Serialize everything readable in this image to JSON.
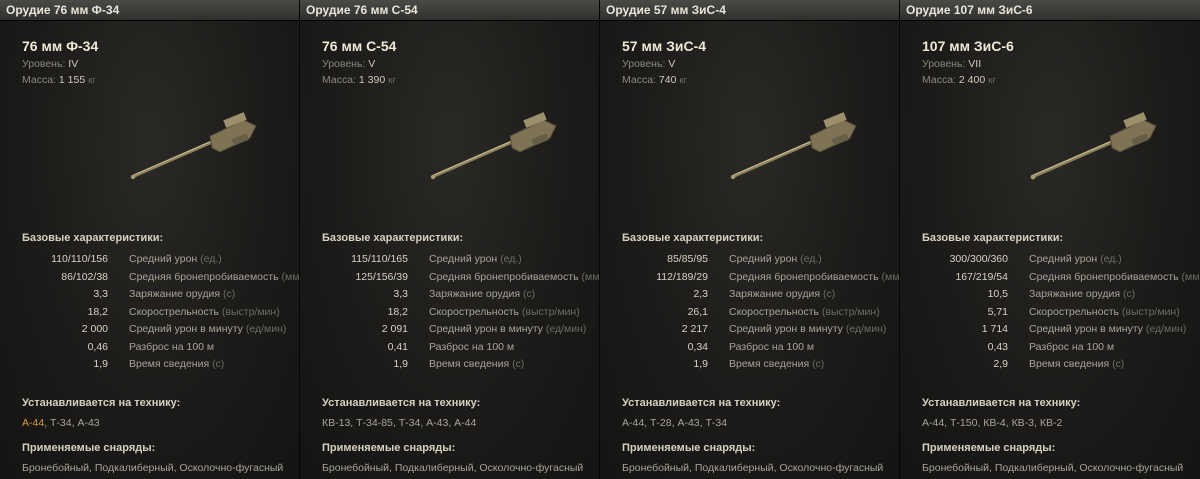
{
  "cards": [
    {
      "header": "Орудие 76 мм Ф-34",
      "name": "76 мм Ф-34",
      "level_label": "Уровень:",
      "level": "IV",
      "mass_label": "Масса:",
      "mass": "1 155",
      "mass_unit": "кг",
      "base_title": "Базовые характеристики:",
      "stats": [
        {
          "value": "110/110/156",
          "label": "Средний урон",
          "unit": "(ед.)"
        },
        {
          "value": "86/102/38",
          "label": "Средняя бронепробиваемость",
          "unit": "(мм)"
        },
        {
          "value": "3,3",
          "label": "Заряжание орудия",
          "unit": "(с)"
        },
        {
          "value": "18,2",
          "label": "Скорострельность",
          "unit": "(выстр/мин)"
        },
        {
          "value": "2 000",
          "label": "Средний урон в минуту",
          "unit": "(ед/мин)"
        },
        {
          "value": "0,46",
          "label": "Разброс на 100 м",
          "unit": ""
        },
        {
          "value": "1,9",
          "label": "Время сведения",
          "unit": "(с)"
        }
      ],
      "installed_title": "Устанавливается на технику:",
      "installed_highlight": "А-44",
      "installed_rest": ", Т-34, А-43",
      "ammo_title": "Применяемые снаряды:",
      "ammo": "Бронебойный, Подкалиберный, Осколочно-фугасный"
    },
    {
      "header": "Орудие 76 мм С-54",
      "name": "76 мм С-54",
      "level_label": "Уровень:",
      "level": "V",
      "mass_label": "Масса:",
      "mass": "1 390",
      "mass_unit": "кг",
      "base_title": "Базовые характеристики:",
      "stats": [
        {
          "value": "115/110/165",
          "label": "Средний урон",
          "unit": "(ед.)"
        },
        {
          "value": "125/156/39",
          "label": "Средняя бронепробиваемость",
          "unit": "(мм)"
        },
        {
          "value": "3,3",
          "label": "Заряжание орудия",
          "unit": "(с)"
        },
        {
          "value": "18,2",
          "label": "Скорострельность",
          "unit": "(выстр/мин)"
        },
        {
          "value": "2 091",
          "label": "Средний урон в минуту",
          "unit": "(ед/мин)"
        },
        {
          "value": "0,41",
          "label": "Разброс на 100 м",
          "unit": ""
        },
        {
          "value": "1,9",
          "label": "Время сведения",
          "unit": "(с)"
        }
      ],
      "installed_title": "Устанавливается на технику:",
      "installed_highlight": "",
      "installed_rest": "КВ-13, Т-34-85, Т-34, А-43, А-44",
      "ammo_title": "Применяемые снаряды:",
      "ammo": "Бронебойный, Подкалиберный, Осколочно-фугасный"
    },
    {
      "header": "Орудие 57 мм ЗиС-4",
      "name": "57 мм ЗиС-4",
      "level_label": "Уровень:",
      "level": "V",
      "mass_label": "Масса:",
      "mass": "740",
      "mass_unit": "кг",
      "base_title": "Базовые характеристики:",
      "stats": [
        {
          "value": "85/85/95",
          "label": "Средний урон",
          "unit": "(ед.)"
        },
        {
          "value": "112/189/29",
          "label": "Средняя бронепробиваемость",
          "unit": "(мм)"
        },
        {
          "value": "2,3",
          "label": "Заряжание орудия",
          "unit": "(с)"
        },
        {
          "value": "26,1",
          "label": "Скорострельность",
          "unit": "(выстр/мин)"
        },
        {
          "value": "2 217",
          "label": "Средний урон в минуту",
          "unit": "(ед/мин)"
        },
        {
          "value": "0,34",
          "label": "Разброс на 100 м",
          "unit": ""
        },
        {
          "value": "1,9",
          "label": "Время сведения",
          "unit": "(с)"
        }
      ],
      "installed_title": "Устанавливается на технику:",
      "installed_highlight": "",
      "installed_rest": "А-44, Т-28, А-43, Т-34",
      "ammo_title": "Применяемые снаряды:",
      "ammo": "Бронебойный, Подкалиберный, Осколочно-фугасный"
    },
    {
      "header": "Орудие 107 мм ЗиС-6",
      "name": "107 мм ЗиС-6",
      "level_label": "Уровень:",
      "level": "VII",
      "mass_label": "Масса:",
      "mass": "2 400",
      "mass_unit": "кг",
      "base_title": "Базовые характеристики:",
      "stats": [
        {
          "value": "300/300/360",
          "label": "Средний урон",
          "unit": "(ед.)"
        },
        {
          "value": "167/219/54",
          "label": "Средняя бронепробиваемость",
          "unit": "(мм)"
        },
        {
          "value": "10,5",
          "label": "Заряжание орудия",
          "unit": "(с)"
        },
        {
          "value": "5,71",
          "label": "Скорострельность",
          "unit": "(выстр/мин)"
        },
        {
          "value": "1 714",
          "label": "Средний урон в минуту",
          "unit": "(ед/мин)"
        },
        {
          "value": "0,43",
          "label": "Разброс на 100 м",
          "unit": ""
        },
        {
          "value": "2,9",
          "label": "Время сведения",
          "unit": "(с)"
        }
      ],
      "installed_title": "Устанавливается на технику:",
      "installed_highlight": "",
      "installed_rest": "А-44, Т-150, КВ-4, КВ-3, КВ-2",
      "ammo_title": "Применяемые снаряды:",
      "ammo": "Бронебойный, Подкалиберный, Осколочно-фугасный"
    }
  ]
}
